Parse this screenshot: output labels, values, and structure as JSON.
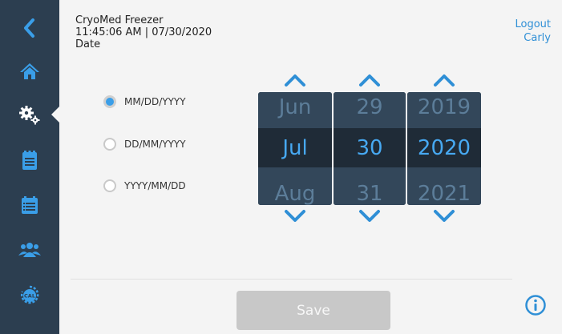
{
  "header": {
    "app_name": "CryoMed Freezer",
    "datetime": "11:45:06 AM | 07/30/2020",
    "page": "Date"
  },
  "user": {
    "logout_label": "Logout",
    "name": "Carly"
  },
  "nav": {
    "items": [
      "back-icon",
      "home-icon",
      "settings-icon",
      "clipboard-icon",
      "calendar-list-icon",
      "users-icon",
      "calibration-icon"
    ],
    "calibration_text": "CAL",
    "active": "settings-icon"
  },
  "format_options": [
    {
      "label": "MM/DD/YYYY",
      "selected": true
    },
    {
      "label": "DD/MM/YYYY",
      "selected": false
    },
    {
      "label": "YYYY/MM/DD",
      "selected": false
    }
  ],
  "picker": {
    "month": {
      "prev": "Jun",
      "current": "Jul",
      "next": "Aug"
    },
    "day": {
      "prev": "29",
      "current": "30",
      "next": "31"
    },
    "year": {
      "prev": "2019",
      "current": "2020",
      "next": "2021"
    }
  },
  "save_label": "Save",
  "colors": {
    "sidebar": "#2c3e50",
    "accent": "#2f8fd6",
    "disabled": "#c8c8c8"
  }
}
